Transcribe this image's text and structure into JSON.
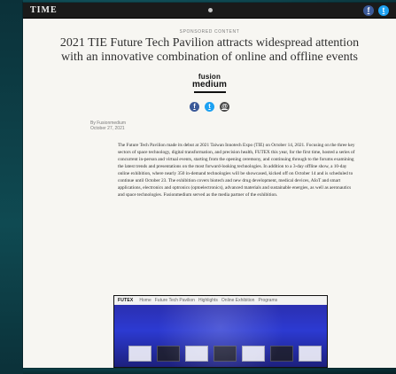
{
  "topbar": {
    "brand": "TIME",
    "social": [
      {
        "icon": "facebook-icon",
        "label": "f",
        "color": "#3b5998"
      },
      {
        "icon": "twitter-icon",
        "label": "t",
        "color": "#1da1f2"
      }
    ]
  },
  "article": {
    "kicker": "SPONSORED CONTENT",
    "headline": "2021 TIE Future Tech Pavilion attracts widespread attention\nwith an innovative combination of online and offline events",
    "logo": {
      "top": "fusion",
      "bottom": "medium"
    },
    "share": [
      {
        "icon": "facebook-icon",
        "label": "f"
      },
      {
        "icon": "twitter-icon",
        "label": "t"
      },
      {
        "icon": "email-icon",
        "label": "@"
      }
    ],
    "byline": {
      "author": "By Fusionmedium",
      "date": "October 27, 2021"
    },
    "body": [
      "The Future Tech Pavilion made its debut at 2021 Taiwan Innotech Expo (TIE) on October 14, 2021. Focusing on the three key sectors of space technology, digital transformation, and precision health, FUTEX this year, for the first time, hosted a series of concurrent in-person and virtual events, starting from the opening ceremony, and continuing through to the forums examining the latest trends and presentations on the most forward-looking technologies. In addition to a 3-day offline show, a 10-day online exhibition, where nearly 350 in-demand technologies will be showcased, kicked off on October 14 and is scheduled to continue until October 23. The exhibition covers biotech and new drug development, medical devices, AIoT and smart applications, electronics and optronics (optoelectronics), advanced materials and sustainable energies, as well as aeronautics and space technologies. Fusionmedium served as the media partner of the exhibition."
    ],
    "image_header": {
      "label": "FUTEX",
      "items": [
        "Home",
        "Future Tech Pavilion",
        "Highlights",
        "Online Exhibition",
        "Programs"
      ]
    }
  }
}
